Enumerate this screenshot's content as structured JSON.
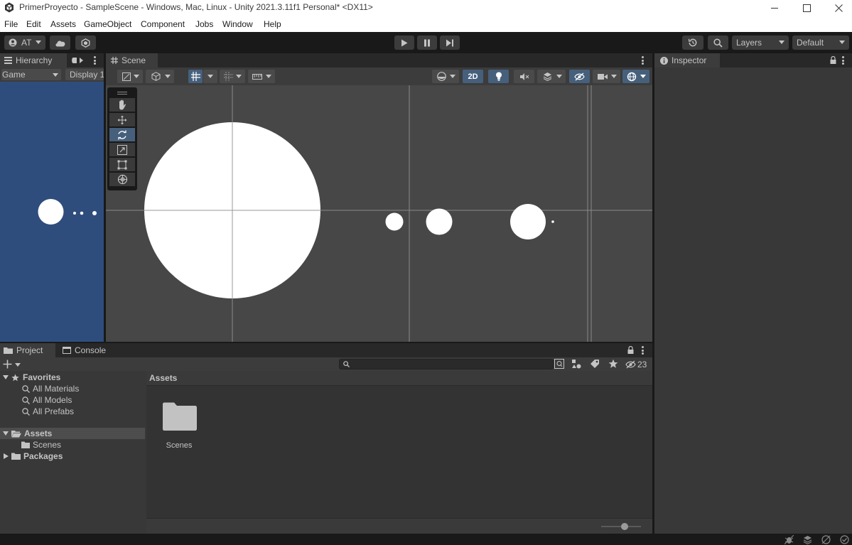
{
  "window": {
    "title": "PrimerProyecto - SampleScene - Windows, Mac, Linux - Unity 2021.3.11f1 Personal* <DX11>"
  },
  "menu": [
    "File",
    "Edit",
    "Assets",
    "GameObject",
    "Component",
    "Jobs",
    "Window",
    "Help"
  ],
  "toolbar": {
    "account": "AT",
    "layers": "Layers",
    "layout": "Default"
  },
  "hierarchy": {
    "tab": "Hierarchy",
    "game_label": "Game",
    "display_label": "Display 1"
  },
  "scene": {
    "tab": "Scene",
    "mode_2d": "2D"
  },
  "inspector": {
    "tab": "Inspector"
  },
  "project": {
    "tab_project": "Project",
    "tab_console": "Console",
    "hidden_count": "23",
    "breadcrumb": "Assets",
    "tree": {
      "favorites": "Favorites",
      "fav_items": [
        "All Materials",
        "All Models",
        "All Prefabs"
      ],
      "assets": "Assets",
      "scenes": "Scenes",
      "packages": "Packages"
    },
    "folder_label": "Scenes"
  },
  "colors": {
    "accent": "#46607c",
    "game_bg": "#2e4d7c",
    "scene_bg": "#474747"
  }
}
